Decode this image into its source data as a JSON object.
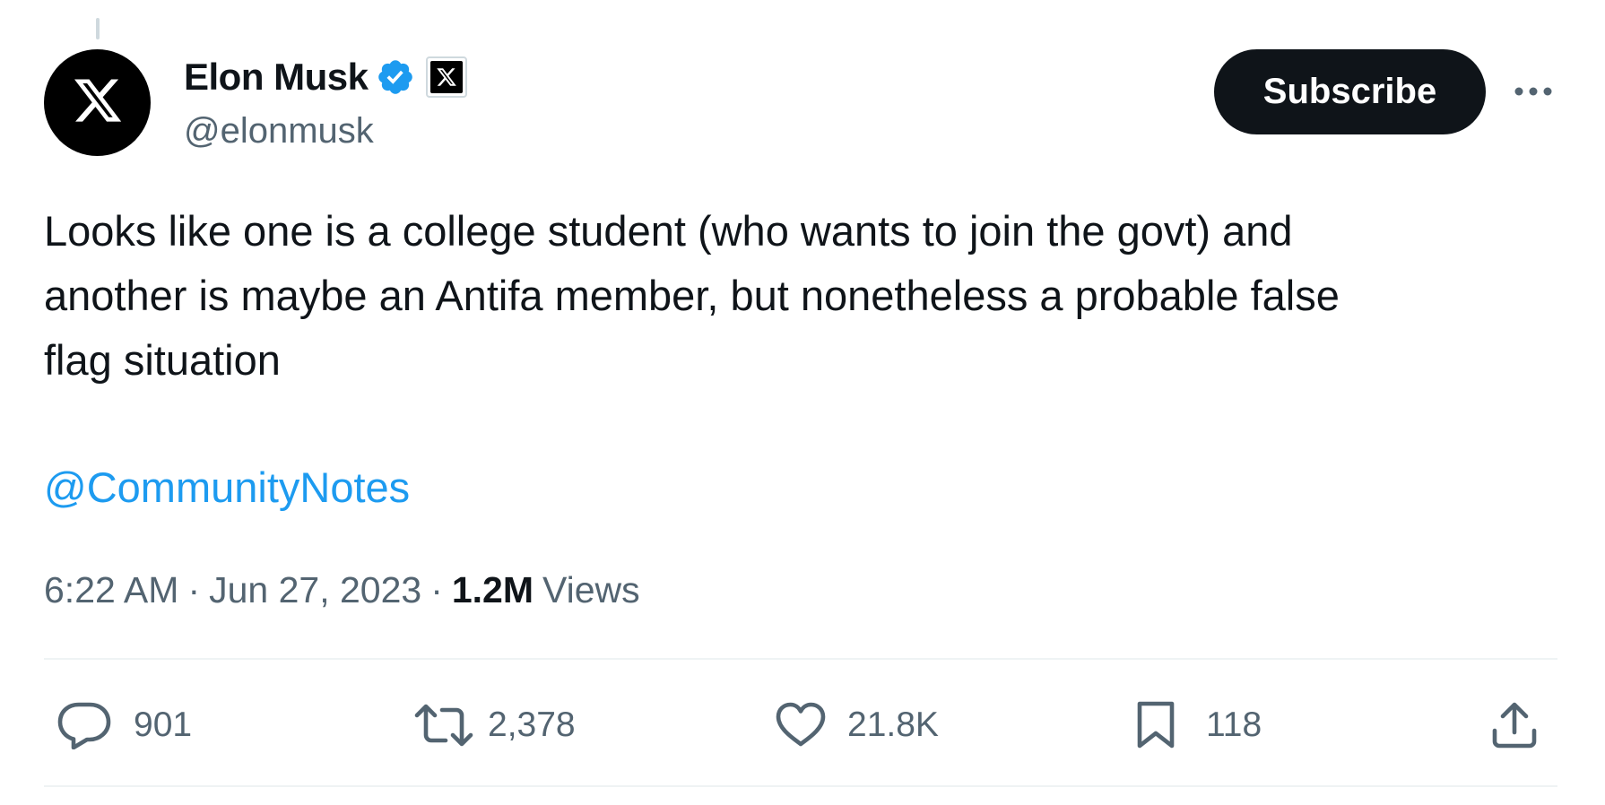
{
  "author": {
    "display_name": "Elon Musk",
    "handle": "@elonmusk",
    "avatar_icon": "x-logo-icon",
    "verified_icon": "verified-badge-icon",
    "affiliation_icon": "x-affiliation-badge-icon"
  },
  "header": {
    "subscribe_label": "Subscribe",
    "more_icon": "more-options-icon"
  },
  "tweet": {
    "lines": [
      "Looks like one is a college student (who wants to join the govt) and",
      "another is maybe an Antifa member, but nonetheless a probable false",
      "flag situation"
    ],
    "mention": "@CommunityNotes"
  },
  "meta": {
    "time": "6:22 AM",
    "separator": "·",
    "date": "Jun 27, 2023",
    "views_count": "1.2M",
    "views_label": "Views"
  },
  "actions": {
    "replies": "901",
    "reposts": "2,378",
    "likes": "21.8K",
    "bookmarks": "118",
    "share_icon": "share-icon"
  },
  "colors": {
    "text_primary": "#0f1419",
    "text_secondary": "#536471",
    "link": "#1d9bf0",
    "verified": "#1d9bf0",
    "divider": "#eff3f4",
    "button_bg": "#0f1419"
  }
}
